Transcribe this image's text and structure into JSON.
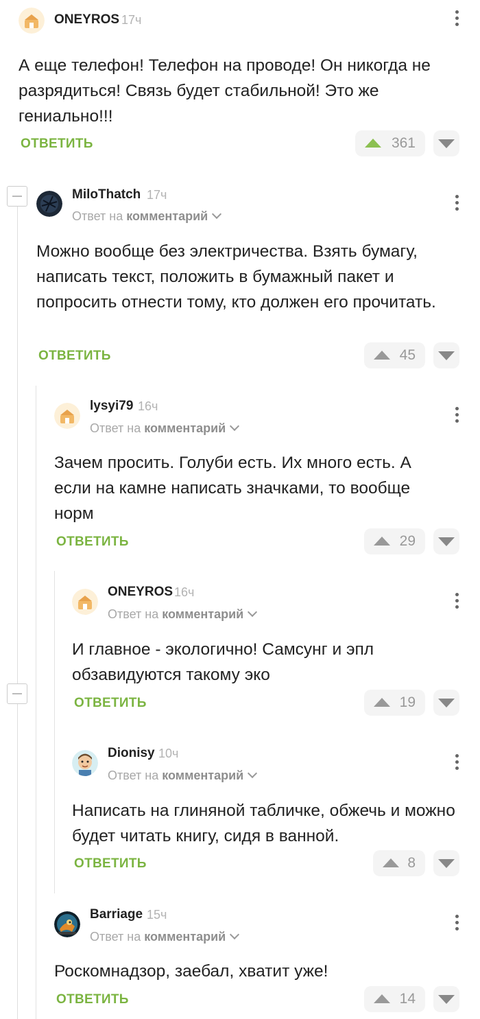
{
  "reply_label": "ОТВЕТИТЬ",
  "reply_to_prefix": "Ответ на",
  "reply_to_link": "комментарий",
  "comments": [
    {
      "author": "ONEYROS",
      "time": "17ч",
      "text": "А еще телефон! Телефон на проводе! Он никогда не разрядиться! Связь будет стабильной! Это же гениально!!!",
      "rating": "361",
      "avatar": "default-pikabu-avatar"
    },
    {
      "author": "MiloThatch",
      "time": "17ч",
      "text": "Можно вообще без электричества. Взять бумагу, написать текст, положить в бумажный пакет и попросить отнести тому, кто должен его прочитать.",
      "rating": "45",
      "avatar": "dark-user-avatar"
    },
    {
      "author": "lysyi79",
      "time": "16ч",
      "text": "Зачем просить. Голуби есть. Их много есть. А если на камне написать значками, то вообще норм",
      "rating": "29",
      "avatar": "default-pikabu-avatar"
    },
    {
      "author": "ONEYROS",
      "time": "16ч",
      "text": "И главное - экологично! Самсунг и эпл обзавидуются такому эко",
      "rating": "19",
      "avatar": "default-pikabu-avatar"
    },
    {
      "author": "Dionisy",
      "time": "10ч",
      "text": "Написать на глиняной табличке, обжечь и можно будет читать книгу, сидя в ванной.",
      "rating": "8",
      "avatar": "cartoon-face-avatar"
    },
    {
      "author": "Barriage",
      "time": "15ч",
      "text": "Роскомнадзор, заебал, хватит уже!",
      "rating": "14",
      "avatar": "cartoon-bird-avatar"
    }
  ],
  "colors": {
    "accent_green": "#7bb441",
    "upvote_green": "#8cc051",
    "muted": "#a8a8a8"
  }
}
